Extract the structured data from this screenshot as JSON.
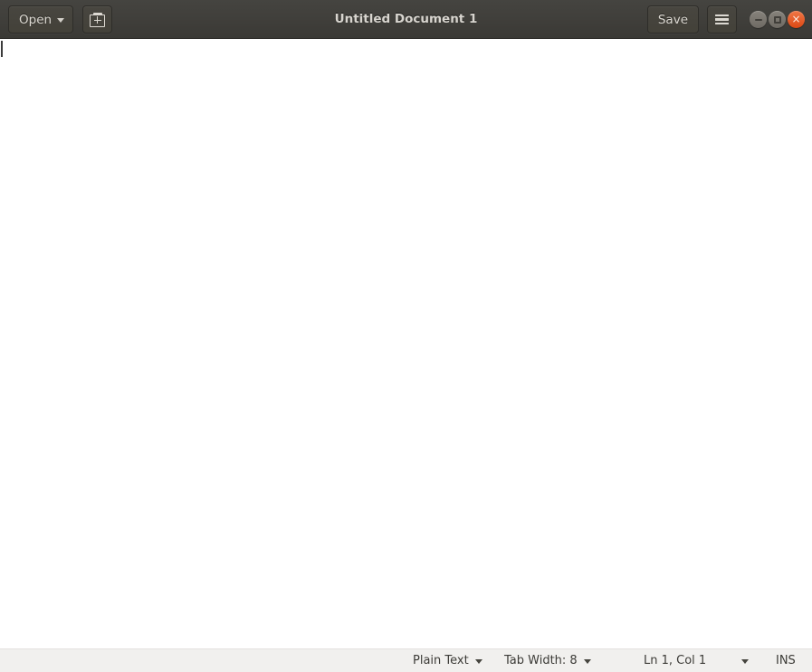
{
  "window": {
    "title": "Untitled Document 1",
    "accent_color": "#dd4814",
    "titlebar_color": "#403f3b",
    "statusbar_color": "#f1f0ee"
  },
  "headerbar": {
    "open_label": "Open",
    "open_icon": "chevron-down-icon",
    "new_document_icon": "new-document-icon",
    "save_label": "Save",
    "menu_icon": "hamburger-menu-icon",
    "window_controls": {
      "minimize_icon": "minimize-icon",
      "maximize_icon": "maximize-icon",
      "close_icon": "close-icon",
      "close_glyph": "×"
    }
  },
  "document": {
    "content": "",
    "cursor_visible": true
  },
  "statusbar": {
    "language": "Plain Text",
    "tab_width": "Tab Width: 8",
    "position": "Ln 1, Col 1",
    "insert_mode": "INS"
  }
}
